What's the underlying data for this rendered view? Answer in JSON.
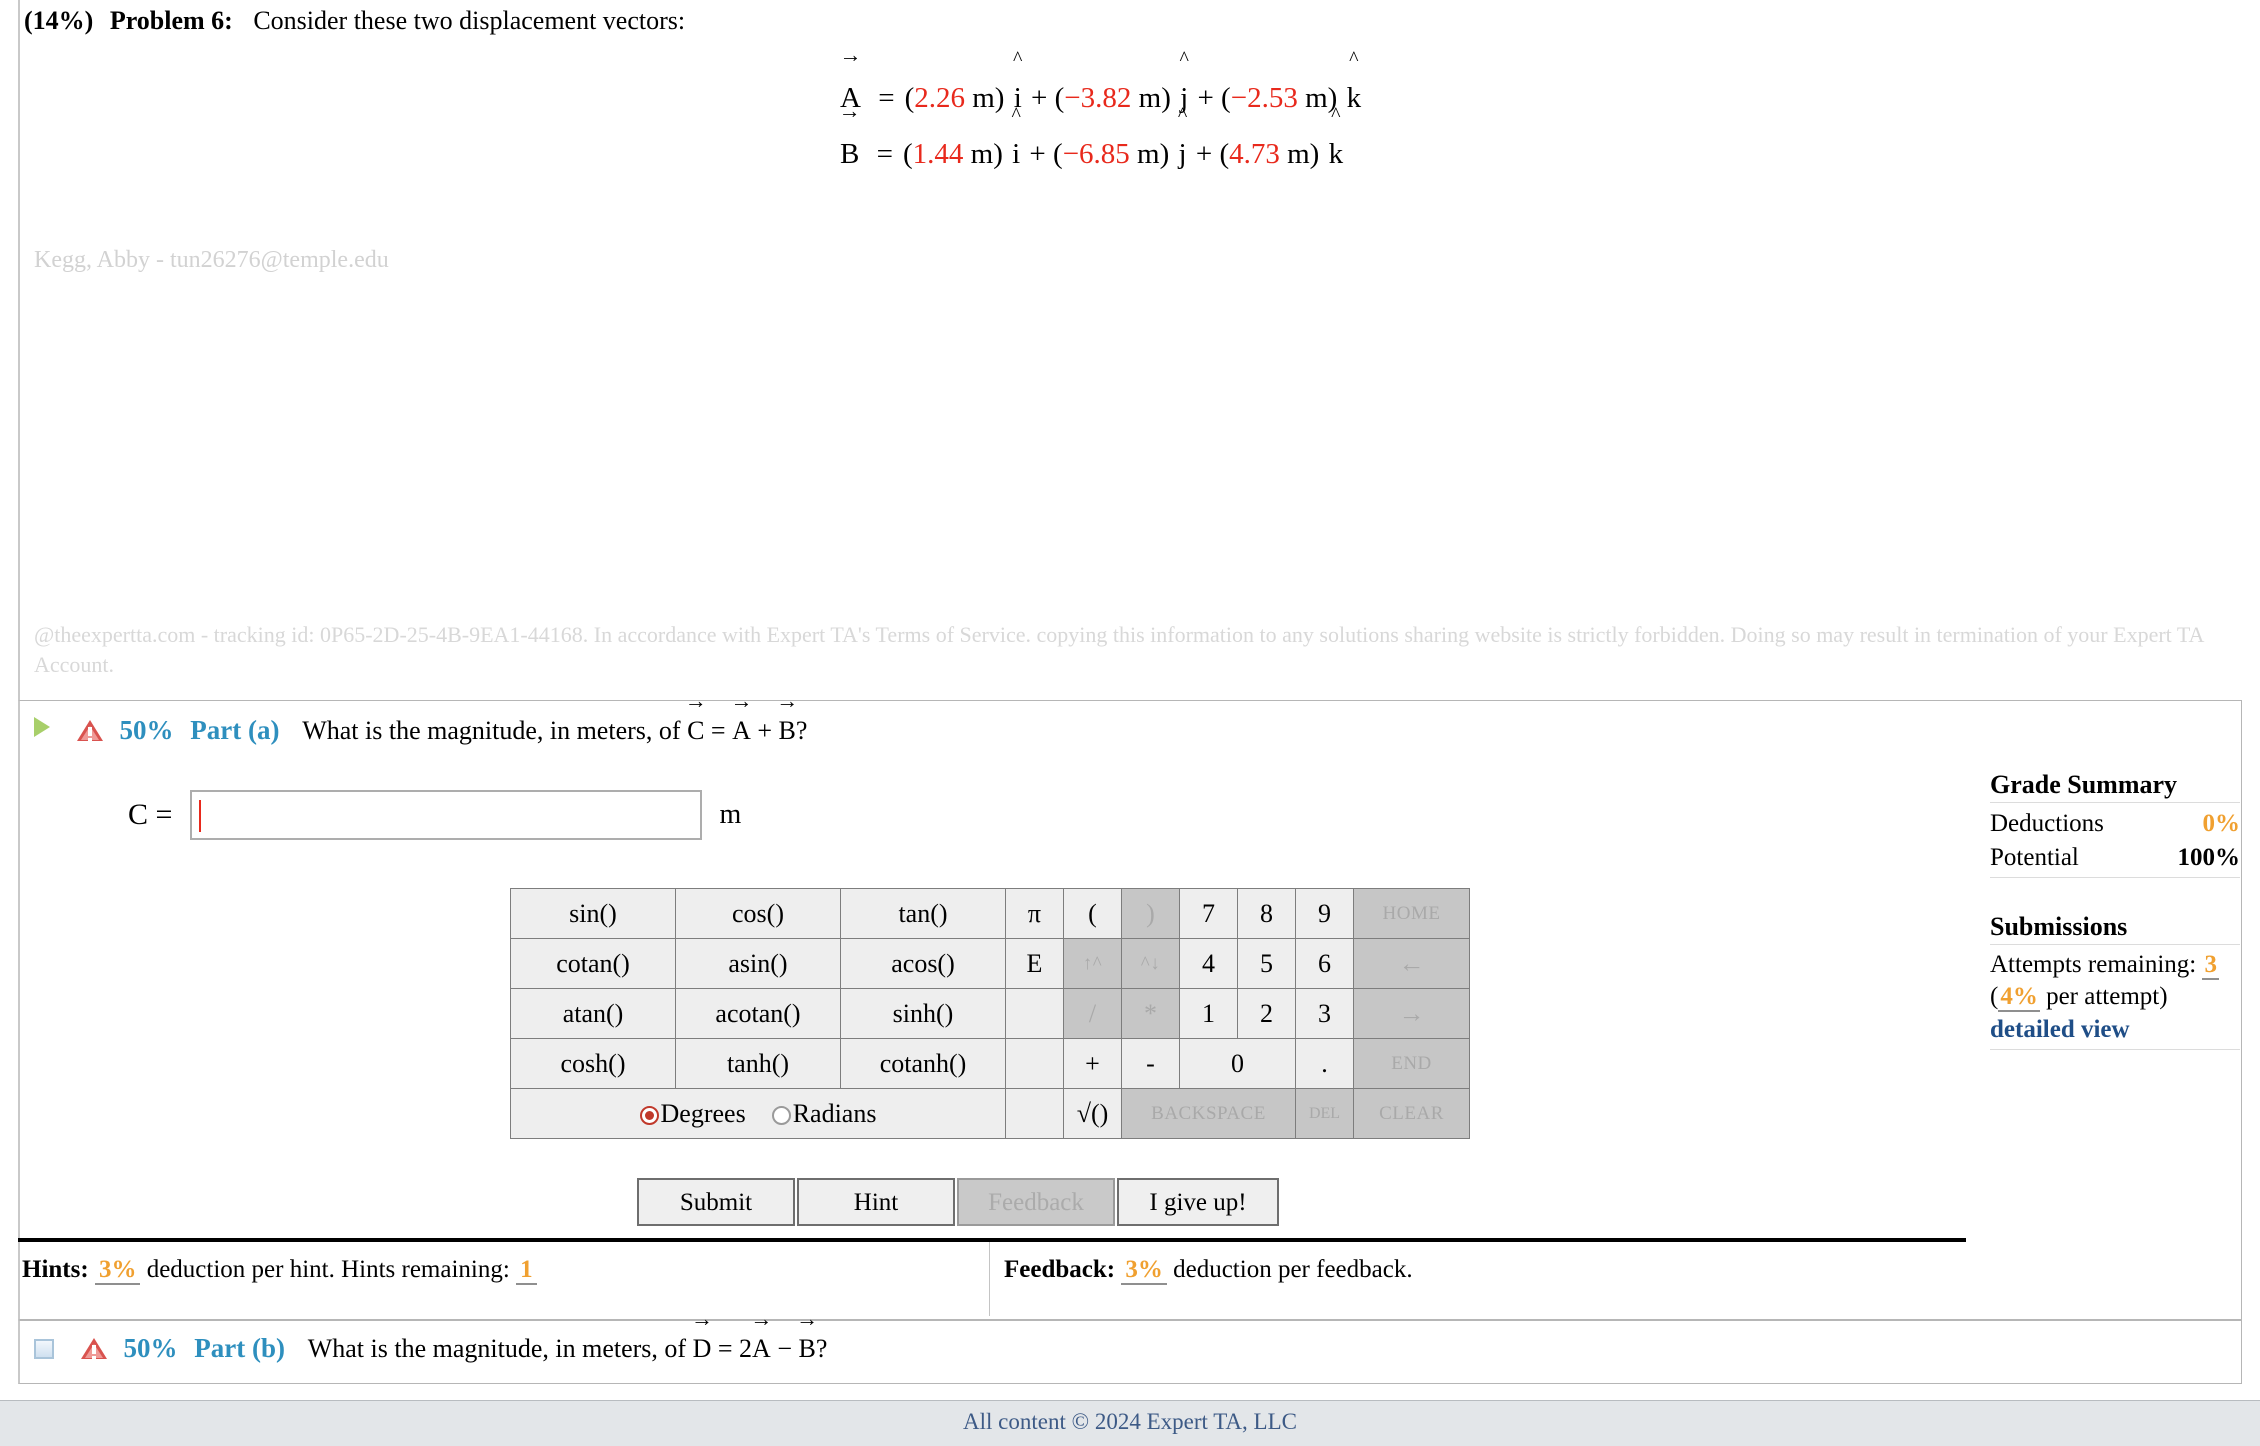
{
  "problem": {
    "percent": "(14%)",
    "number": "Problem 6:",
    "prompt": "Consider these two displacement vectors:",
    "vectors": [
      {
        "name": "A",
        "terms": [
          {
            "value": "2.26",
            "unit": "m",
            "basis": "i"
          },
          {
            "value": "−3.82",
            "unit": "m",
            "basis": "j"
          },
          {
            "value": "−2.53",
            "unit": "m",
            "basis": "k"
          }
        ]
      },
      {
        "name": "B",
        "terms": [
          {
            "value": "1.44",
            "unit": "m",
            "basis": "i"
          },
          {
            "value": "−6.85",
            "unit": "m",
            "basis": "j"
          },
          {
            "value": "4.73",
            "unit": "m",
            "basis": "k"
          }
        ]
      }
    ],
    "student_watermark": "Kegg, Abby - tun26276@temple.edu",
    "tracking_notice": "@theexpertta.com - tracking id: 0P65-2D-25-4B-9EA1-44168. In accordance with Expert TA's Terms of Service. copying this information to any solutions sharing website is strictly forbidden. Doing so may result in termination of your Expert TA Account."
  },
  "part_a": {
    "percent": "50%",
    "label": "Part (a)",
    "question": "What is the magnitude, in meters, of C = A + B?",
    "question_prefix": "What is the magnitude, in meters, of ",
    "answer_var": "C =",
    "answer_value": "",
    "answer_unit": "m",
    "expand_icon": "play-triangle-icon",
    "status_icon": "warning-icon"
  },
  "part_b": {
    "percent": "50%",
    "label": "Part (b)",
    "question_prefix": "What is the magnitude, in meters, of ",
    "expand_icon": "collapsed-box-icon",
    "status_icon": "warning-icon"
  },
  "keypad": {
    "functions": [
      [
        "sin()",
        "cos()",
        "tan()"
      ],
      [
        "cotan()",
        "asin()",
        "acos()"
      ],
      [
        "atan()",
        "acotan()",
        "sinh()"
      ],
      [
        "cosh()",
        "tanh()",
        "cotanh()"
      ]
    ],
    "constants": [
      "π",
      "E",
      "",
      "",
      ""
    ],
    "row1": {
      "open_paren": "(",
      "close_paren": ")",
      "n7": "7",
      "n8": "8",
      "n9": "9",
      "home": "HOME"
    },
    "row2": {
      "pow_up": "↑^",
      "pow_dn": "^↓",
      "n4": "4",
      "n5": "5",
      "n6": "6",
      "left": "←"
    },
    "row3": {
      "divide": "/",
      "multiply": "*",
      "n1": "1",
      "n2": "2",
      "n3": "3",
      "right": "→"
    },
    "row4": {
      "plus": "+",
      "minus": "-",
      "n0": "0",
      "dot": ".",
      "end": "END"
    },
    "row5": {
      "sqrt": "√()",
      "backspace": "BACKSPACE",
      "del": "DEL",
      "clear": "CLEAR"
    },
    "angle_mode": {
      "degrees": "Degrees",
      "radians": "Radians",
      "selected": "Degrees"
    }
  },
  "actions": {
    "submit": "Submit",
    "hint": "Hint",
    "feedback": "Feedback",
    "give_up": "I give up!"
  },
  "hints_bar": {
    "hints_label": "Hints:",
    "hints_pct": "3%",
    "hints_text": "deduction per hint. Hints remaining:",
    "hints_remaining": "1",
    "feedback_label": "Feedback:",
    "feedback_pct": "3%",
    "feedback_text": "deduction per feedback."
  },
  "grade_summary": {
    "title": "Grade Summary",
    "deductions_label": "Deductions",
    "deductions_value": "0%",
    "potential_label": "Potential",
    "potential_value": "100%",
    "submissions_title": "Submissions",
    "attempts_label": "Attempts remaining:",
    "attempts_value": "3",
    "per_attempt_open": "(",
    "per_attempt_value": "4%",
    "per_attempt_text": " per attempt)",
    "detailed_view": "detailed view"
  },
  "footer": {
    "copyright": "All content © 2024 Expert TA, LLC"
  },
  "colors": {
    "accent_blue": "#2e8fbe",
    "value_red": "#e8291c",
    "orange": "#f0a030",
    "link_blue": "#1f4e87"
  }
}
